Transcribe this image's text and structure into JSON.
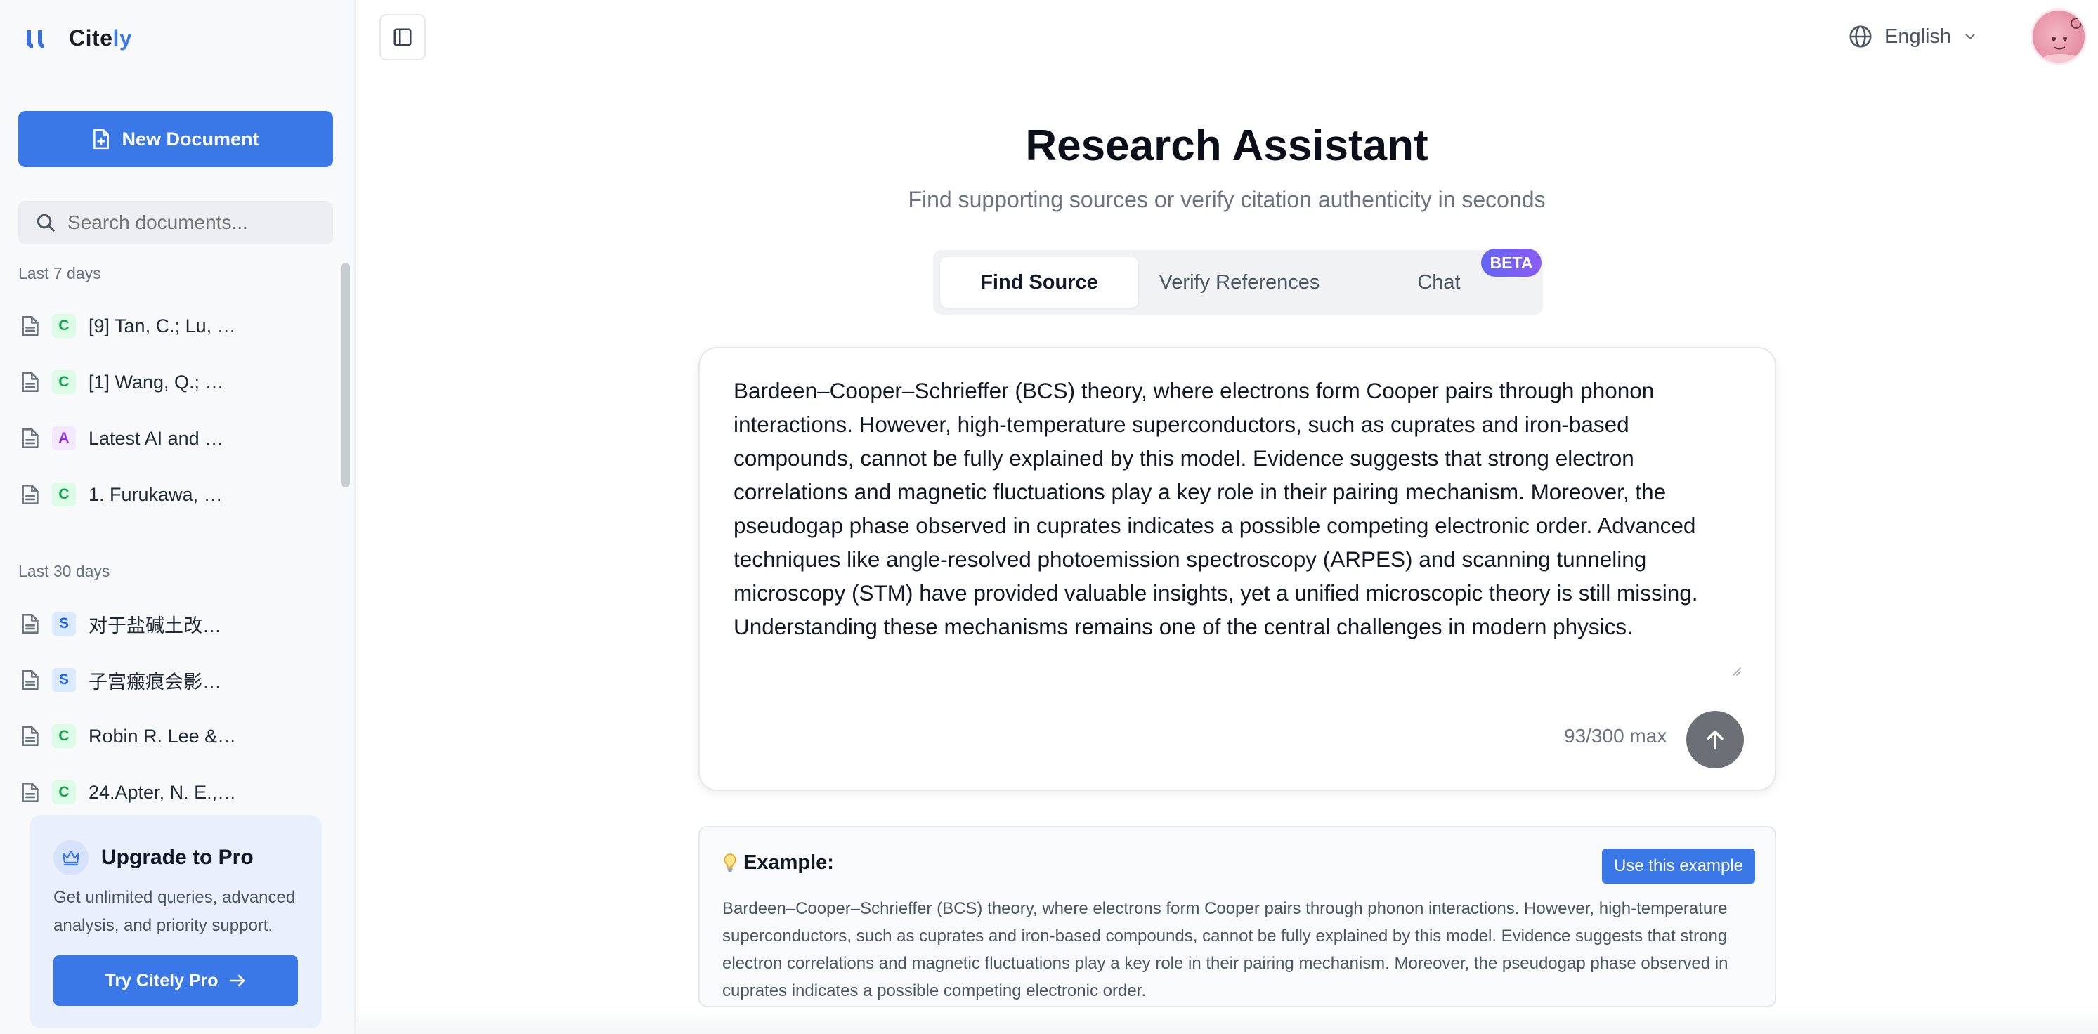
{
  "brand": {
    "name_part1": "Cite",
    "name_part2": "ly",
    "accent": "#3b78e7"
  },
  "sidebar": {
    "new_document_label": "New Document",
    "search": {
      "placeholder": "Search documents..."
    },
    "sections": [
      {
        "label": "Last 7 days",
        "items": [
          {
            "badge": "C",
            "title": "[9] Tan, C.; Lu, …"
          },
          {
            "badge": "C",
            "title": "[1] Wang, Q.; …"
          },
          {
            "badge": "A",
            "title": "Latest AI and …"
          },
          {
            "badge": "C",
            "title": "1. Furukawa, …"
          }
        ]
      },
      {
        "label": "Last 30 days",
        "items": [
          {
            "badge": "S",
            "title": "对于盐碱土改…"
          },
          {
            "badge": "S",
            "title": "子宫瘢痕会影…"
          },
          {
            "badge": "C",
            "title": "Robin R. Lee &…"
          },
          {
            "badge": "C",
            "title": "24.Apter, N. E.,…"
          }
        ]
      }
    ],
    "upgrade": {
      "title": "Upgrade to Pro",
      "description": "Get unlimited queries, advanced analysis, and priority support.",
      "button_label": "Try Citely Pro"
    }
  },
  "header": {
    "language": "English"
  },
  "main": {
    "title": "Research Assistant",
    "subtitle": "Find supporting sources or verify citation authenticity in seconds",
    "tabs": [
      {
        "label": "Find Source",
        "active": true
      },
      {
        "label": "Verify References",
        "active": false
      },
      {
        "label": "Chat",
        "active": false,
        "badge": "BETA"
      }
    ],
    "input": {
      "value": "Bardeen–Cooper–Schrieffer (BCS) theory, where electrons form Cooper pairs through phonon interactions. However, high-temperature superconductors, such as cuprates and iron-based compounds, cannot be fully explained by this model. Evidence suggests that strong electron correlations and magnetic fluctuations play a key role in their pairing mechanism. Moreover, the pseudogap phase observed in cuprates indicates a possible competing electronic order. Advanced techniques like angle-resolved photoemission spectroscopy (ARPES) and scanning tunneling microscopy (STM) have provided valuable insights, yet a unified microscopic theory is still missing. Understanding these mechanisms remains one of the central challenges in modern physics.",
      "char_count": "93/300 max"
    },
    "example": {
      "label": "Example:",
      "use_button": "Use this example",
      "text": "Bardeen–Cooper–Schrieffer (BCS) theory, where electrons form Cooper pairs through phonon interactions. However, high-temperature superconductors, such as cuprates and iron-based compounds, cannot be fully explained by this model. Evidence suggests that strong electron correlations and magnetic fluctuations play a key role in their pairing mechanism. Moreover, the pseudogap phase observed in cuprates indicates a possible competing electronic order."
    }
  },
  "icons": {
    "logo": "citely-logo-icon",
    "new_document": "file-plus-icon",
    "search": "search-icon",
    "document": "file-icon",
    "crown": "crown-icon",
    "arrow": "arrow-right-icon",
    "sidebar_toggle": "sidebar-toggle-icon",
    "globe": "globe-icon",
    "chevron": "chevron-down-icon",
    "send": "arrow-up-icon",
    "lightbulb": "lightbulb-icon"
  }
}
